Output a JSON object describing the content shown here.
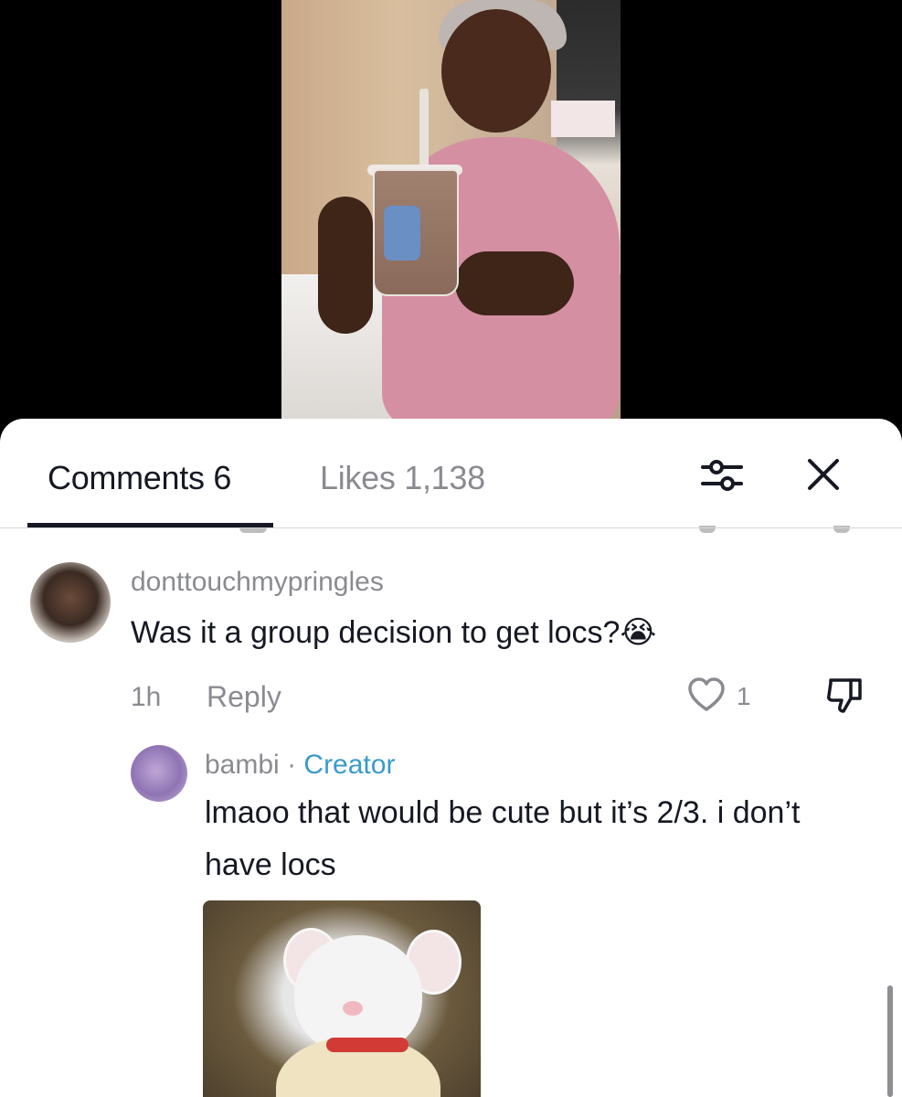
{
  "tabs": {
    "comments_label": "Comments 6",
    "likes_label": "Likes 1,138"
  },
  "icons": {
    "filter": "sliders-icon",
    "close": "close-icon",
    "like": "heart-icon",
    "dislike": "thumbs-down-icon",
    "emoji": "crying-face-emoji"
  },
  "comments": [
    {
      "username": "donttouchmypringles",
      "text": "Was it a group decision to get locs?",
      "emoji": "😭",
      "time": "1h",
      "reply_label": "Reply",
      "likes": "1",
      "replies": [
        {
          "username": "bambi",
          "separator": "·",
          "badge": "Creator",
          "text": "lmaoo that would be cute but it’s 2/3. i don’t have locs"
        }
      ]
    }
  ],
  "colors": {
    "creator_badge": "#3a9bc9",
    "text_primary": "#161823",
    "text_secondary": "#8a8b91"
  }
}
